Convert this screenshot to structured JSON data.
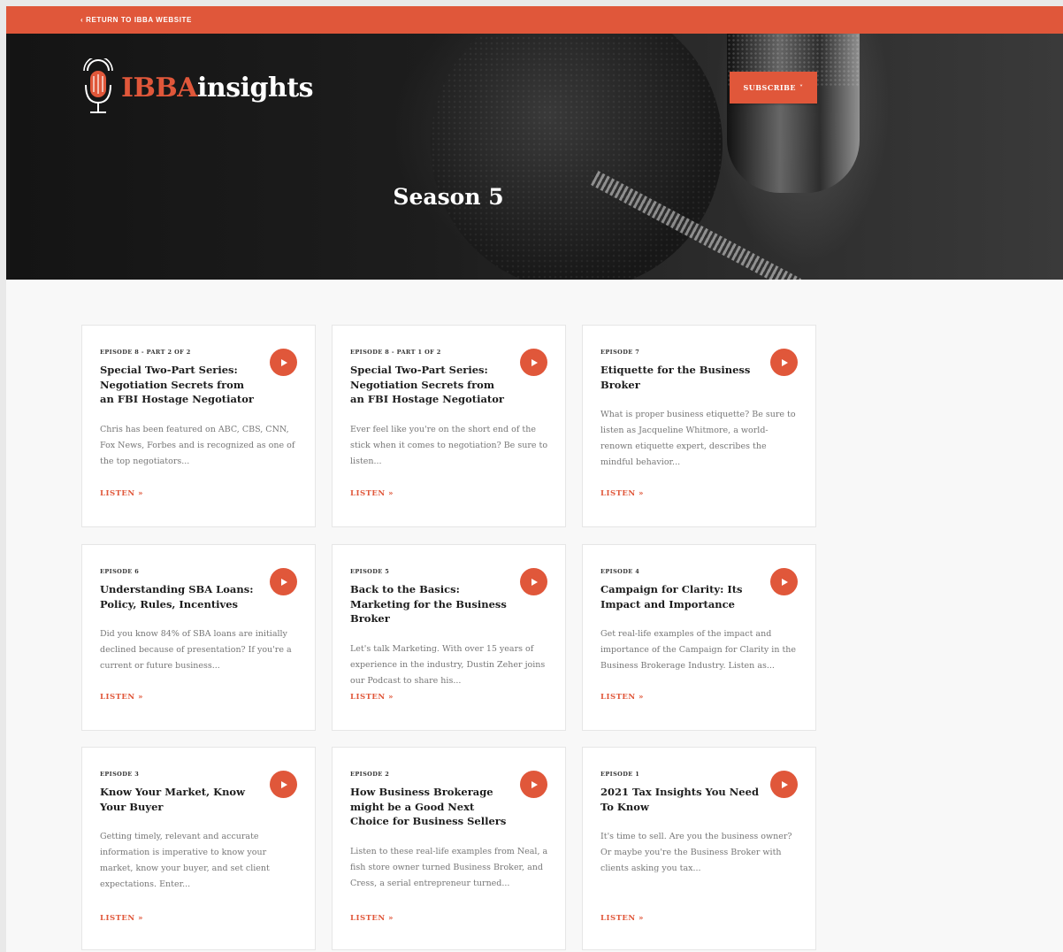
{
  "topbar": {
    "return_link": "‹ RETURN TO IBBA WEBSITE"
  },
  "brand": {
    "logo_part1": "IBBA",
    "logo_part2": "insights"
  },
  "header": {
    "subscribe_label": "SUBSCRIBE",
    "subscribe_caret": "˅"
  },
  "hero": {
    "title": "Season 5"
  },
  "colors": {
    "accent": "#e0573a",
    "background": "#f8f8f8"
  },
  "episodes": [
    {
      "label": "EPISODE 8 - PART 2 OF 2",
      "title": "Special Two-Part Series: Negotiation Secrets from an FBI Hostage Negotiator",
      "description": "Chris has been featured on ABC, CBS, CNN, Fox News, Forbes and is recognized as one of the top negotiators...",
      "listen": "LISTEN »"
    },
    {
      "label": "EPISODE 8 - PART 1 OF 2",
      "title": "Special Two-Part Series: Negotiation Secrets from an FBI Hostage Negotiator",
      "description": "Ever feel like you're on the short end of the stick when it comes to negotiation? Be sure to listen...",
      "listen": "LISTEN »"
    },
    {
      "label": "EPISODE 7",
      "title": "Etiquette for the Business Broker",
      "description": "What is proper business etiquette? Be sure to listen as Jacqueline Whitmore, a world-renown etiquette expert, describes the mindful behavior...",
      "listen": "LISTEN »"
    },
    {
      "label": "EPISODE 6",
      "title": "Understanding SBA Loans: Policy, Rules, Incentives",
      "description": "Did you know 84% of SBA loans are initially declined because of presentation? If you're a current or future business...",
      "listen": "LISTEN »"
    },
    {
      "label": "EPISODE 5",
      "title": "Back to the Basics: Marketing for the Business Broker",
      "description": "Let's talk Marketing. With over 15 years of experience in the industry, Dustin Zeher joins our Podcast to share his...",
      "listen": "LISTEN »"
    },
    {
      "label": "EPISODE 4",
      "title": "Campaign for Clarity: Its Impact and Importance",
      "description": "Get real-life examples of the impact and importance of the Campaign for Clarity in the Business Brokerage Industry. Listen as...",
      "listen": "LISTEN »"
    },
    {
      "label": "EPISODE 3",
      "title": "Know Your Market, Know Your Buyer",
      "description": "Getting timely, relevant and accurate information is imperative to know your market, know your buyer, and set client expectations. Enter...",
      "listen": "LISTEN »"
    },
    {
      "label": "EPISODE 2",
      "title": "How Business Brokerage might be a Good Next Choice for Business Sellers",
      "description": "Listen to these real-life examples from Neal, a fish store owner turned Business Broker, and Cress, a serial entrepreneur turned...",
      "listen": "LISTEN »"
    },
    {
      "label": "EPISODE 1",
      "title": "2021 Tax Insights You Need To Know",
      "description": "It's time to sell. Are you the business owner? Or maybe you're the Business Broker with clients asking you tax...",
      "listen": "LISTEN »"
    }
  ]
}
